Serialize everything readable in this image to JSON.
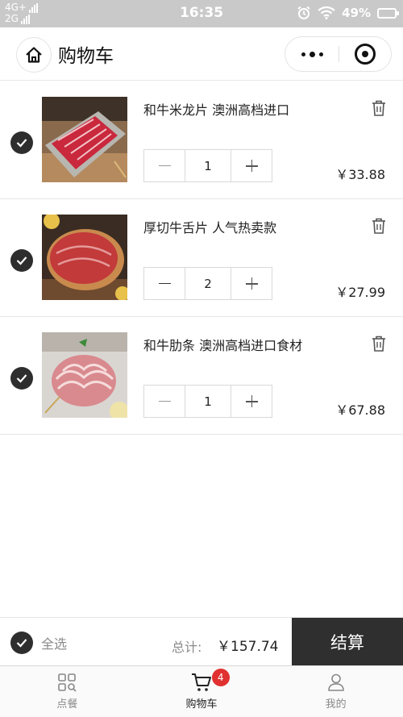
{
  "status_bar": {
    "network_top": "4G+",
    "network_bottom": "2G",
    "time": "16:35",
    "battery": "49%"
  },
  "header": {
    "title": "购物车"
  },
  "items": [
    {
      "name": "和牛米龙片 澳洲高档进口",
      "quantity": "1",
      "price": "￥33.88",
      "image": "sliced-beef-platter"
    },
    {
      "name": "厚切牛舌片 人气热卖款",
      "quantity": "2",
      "price": "￥27.99",
      "image": "beef-tongue-slices"
    },
    {
      "name": "和牛肋条 澳洲高档进口食材",
      "quantity": "1",
      "price": "￥67.88",
      "image": "rolled-beef-slices"
    }
  ],
  "footer": {
    "select_all": "全选",
    "total_label": "总计:",
    "total_value": "￥157.74",
    "checkout": "结算"
  },
  "tabbar": {
    "tabs": [
      {
        "label": "点餐",
        "icon": "grid-search-icon"
      },
      {
        "label": "购物车",
        "icon": "cart-icon",
        "badge": "4"
      },
      {
        "label": "我的",
        "icon": "person-icon"
      }
    ]
  },
  "colors": {
    "accent_dark": "#2f2f2f",
    "badge_red": "#e03030"
  }
}
